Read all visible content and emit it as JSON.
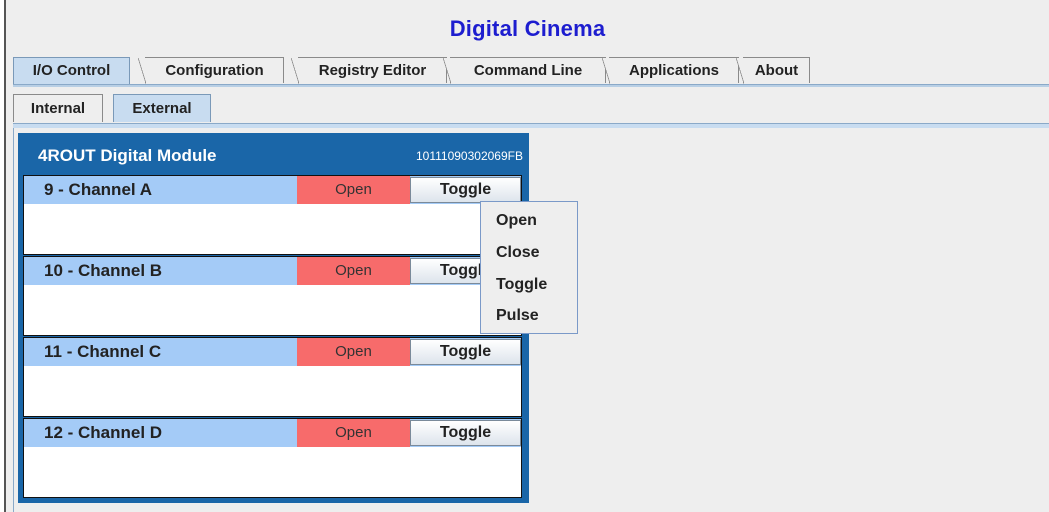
{
  "app": {
    "title": "Digital Cinema"
  },
  "tabs": [
    {
      "label": "I/O Control",
      "selected": true
    },
    {
      "label": "Configuration",
      "selected": false
    },
    {
      "label": "Registry Editor",
      "selected": false
    },
    {
      "label": "Command Line",
      "selected": false
    },
    {
      "label": "Applications",
      "selected": false
    },
    {
      "label": "About",
      "selected": false
    }
  ],
  "subtabs": [
    {
      "label": "Internal",
      "selected": false
    },
    {
      "label": "External",
      "selected": true
    }
  ],
  "module": {
    "title": "4ROUT Digital Module",
    "serial": "10111090302069FB",
    "channels": [
      {
        "name": "9 - Channel A",
        "status": "Open",
        "button": "Toggle"
      },
      {
        "name": "10 - Channel B",
        "status": "Open",
        "button": "Toggle"
      },
      {
        "name": "11 - Channel C",
        "status": "Open",
        "button": "Toggle"
      },
      {
        "name": "12 - Channel D",
        "status": "Open",
        "button": "Toggle"
      }
    ]
  },
  "popup_menu": {
    "items": [
      "Open",
      "Close",
      "Toggle",
      "Pulse"
    ]
  },
  "colors": {
    "title": "#1d1dcf",
    "module_bg": "#1a66a8",
    "channel_header": "#a4cbf7",
    "status_open": "#f76b6b",
    "tab_selected": "#c8dcf0"
  }
}
